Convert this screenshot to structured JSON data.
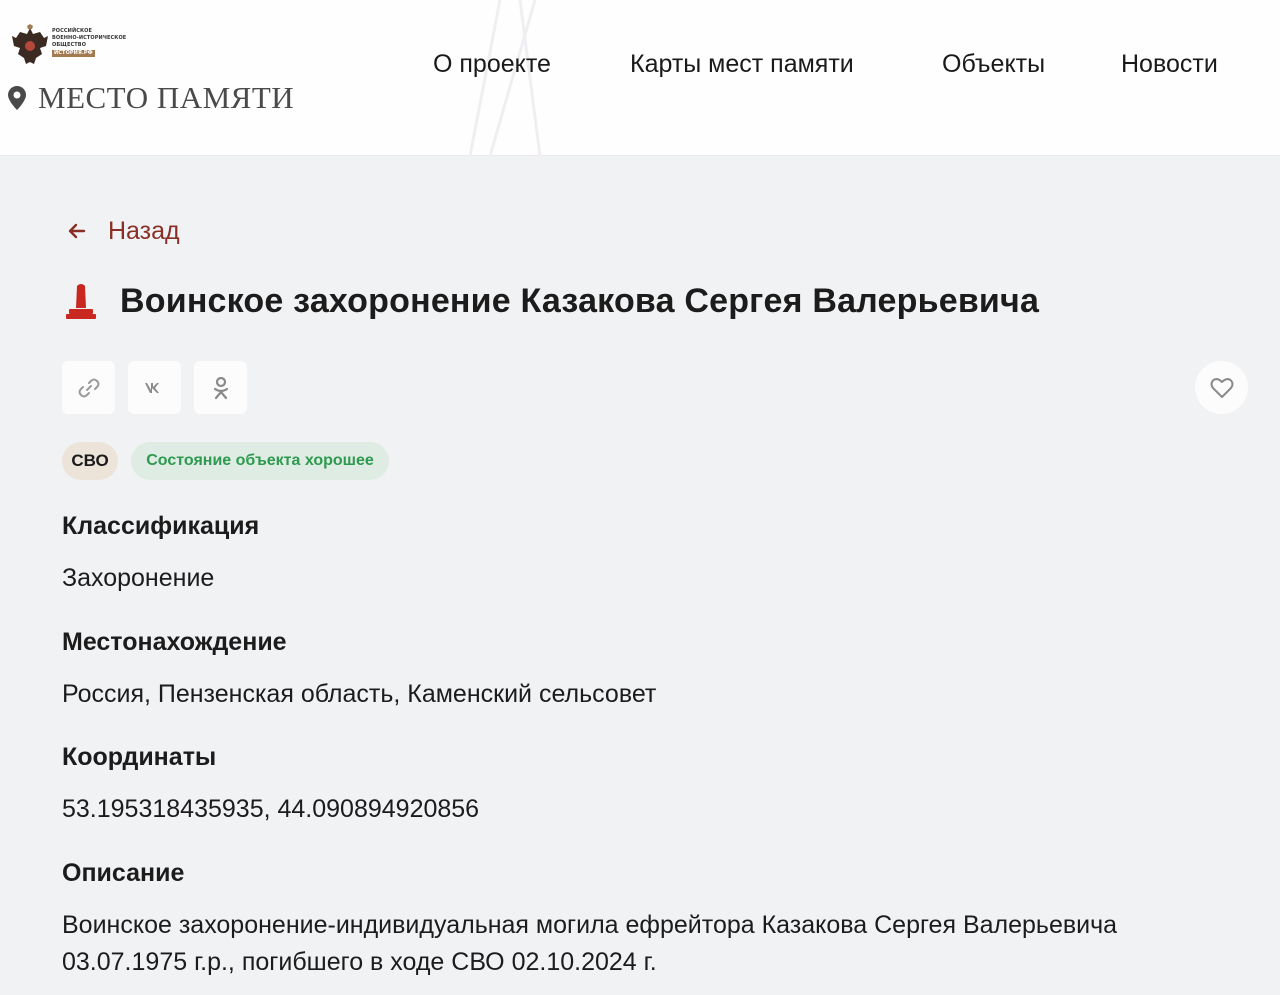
{
  "header": {
    "logo": {
      "org_line1": "Российское",
      "org_line2": "военно-историческое",
      "org_line3": "общество",
      "org_tag": "история.рф"
    },
    "site_name": "МЕСТО ПАМЯТИ",
    "nav": [
      {
        "label": "О проекте"
      },
      {
        "label": "Карты мест памяти"
      },
      {
        "label": "Объекты"
      },
      {
        "label": "Новости"
      }
    ]
  },
  "page": {
    "back_label": "Назад",
    "title": "Воинское захоронение Казакова Сергея Валерьевича",
    "share_icons": [
      "link-icon",
      "vk-icon",
      "ok-icon"
    ],
    "favorite_icon": "heart-icon",
    "badges": {
      "category": "СВО",
      "state": "Состояние объекта хорошее"
    },
    "fields": {
      "classification_label": "Классификация",
      "classification_value": "Захоронение",
      "location_label": "Местонахождение",
      "location_value": "Россия, Пензенская область, Каменский сельсовет",
      "coordinates_label": "Координаты",
      "coordinates_value": "53.195318435935, 44.090894920856",
      "description_label": "Описание",
      "description_value": "Воинское захоронение-индивидуальная могила ефрейтора Казакова Сергея Валерьевича 03.07.1975 г.р., погибшего в ходе СВО 02.10.2024 г."
    }
  },
  "colors": {
    "accent": "#8a2f26",
    "monument": "#c8281f",
    "state_text": "#2e9a4f",
    "state_bg": "#dfece4",
    "category_bg": "#ece4d9",
    "page_bg": "#f1f2f4"
  }
}
